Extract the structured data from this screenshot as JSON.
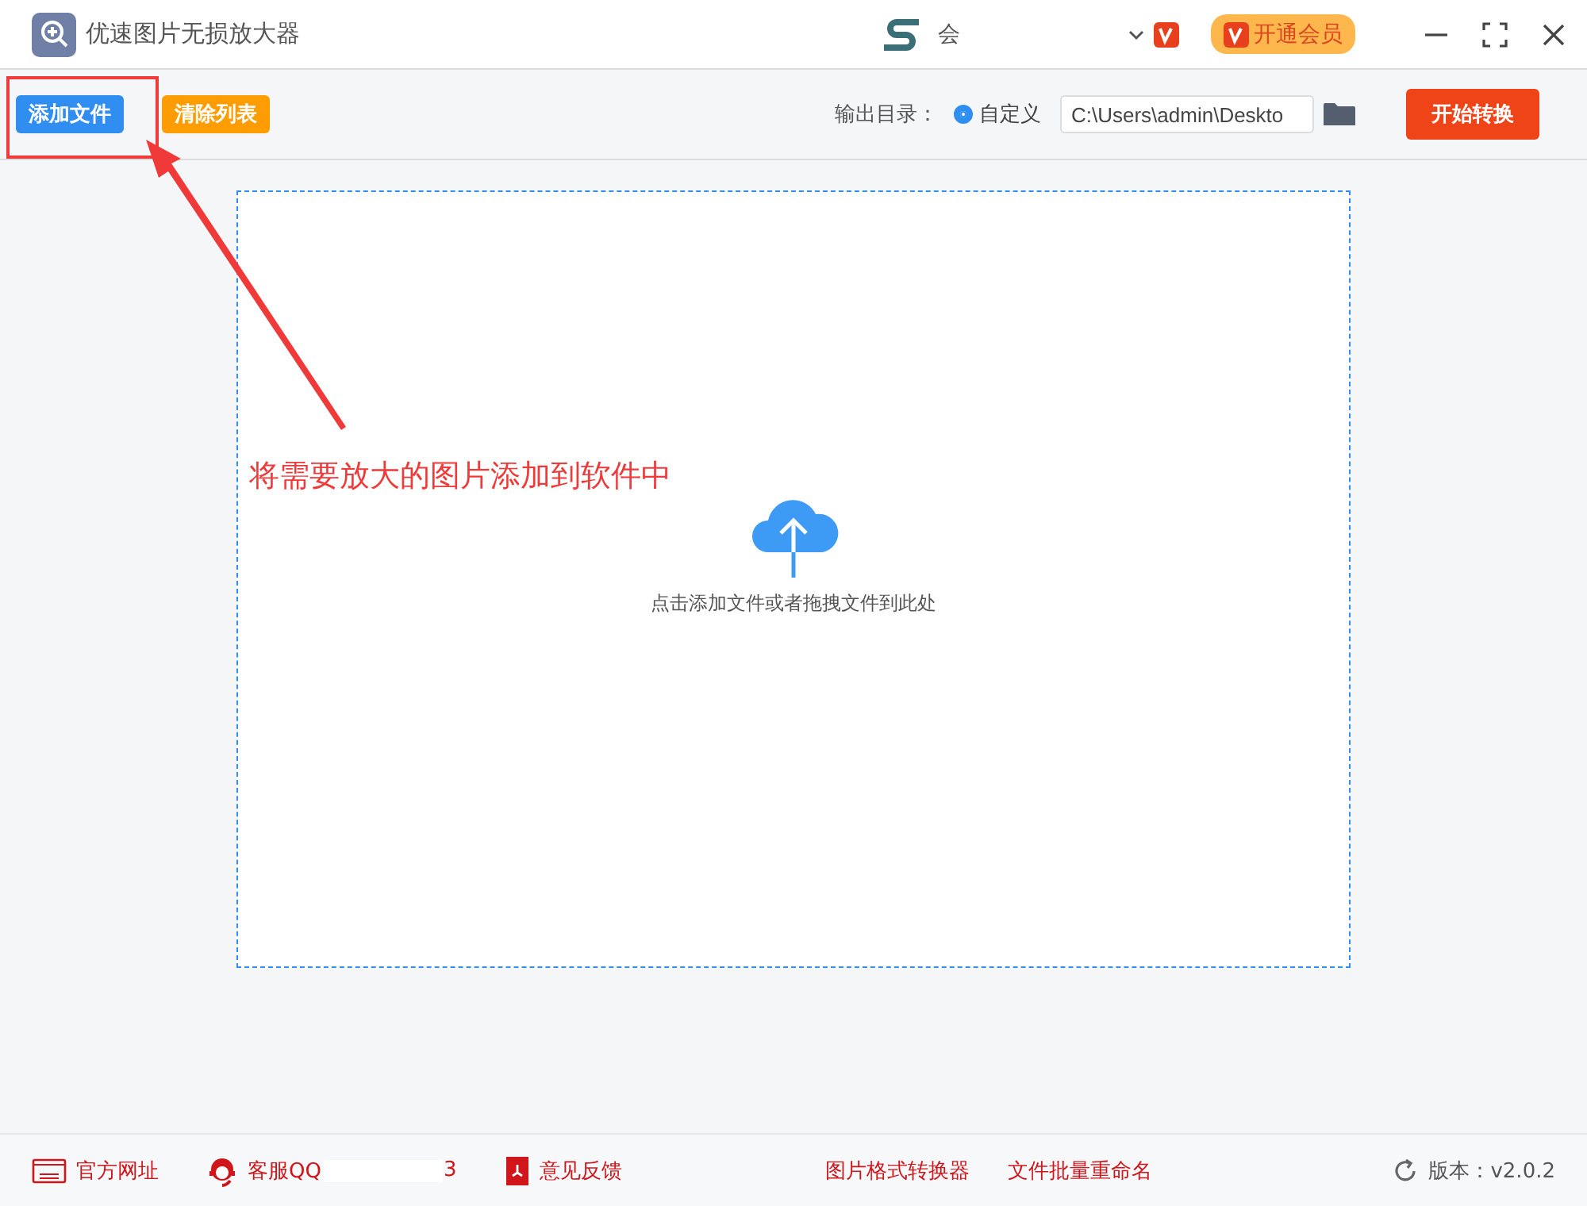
{
  "window": {
    "title": "优速图片无损放大器"
  },
  "account": {
    "name": "会"
  },
  "vip_button": {
    "label": "开通会员"
  },
  "toolbar": {
    "buttons": [
      {
        "label": "添加文件",
        "kind": "primary"
      },
      {
        "label": "清除列表",
        "kind": "warning"
      }
    ],
    "output_label": "输出目录：",
    "output_options": [
      {
        "label": "自定义",
        "selected": true
      }
    ],
    "output_path": "C:\\Users\\admin\\Deskto",
    "start_button": "开始转换"
  },
  "drop_zone": {
    "hint": "点击添加文件或者拖拽文件到此处"
  },
  "annotation": {
    "text": "将需要放大的图片添加到软件中"
  },
  "footer": {
    "links": [
      {
        "label": "官方网址",
        "kind": "web"
      },
      {
        "label": "客服QQ",
        "kind": "support",
        "suffix": "3"
      },
      {
        "label": "意见反馈",
        "kind": "feedback"
      }
    ],
    "tools": [
      "图片格式转换器",
      "文件批量重命名"
    ],
    "version": "版本：v2.0.2"
  }
}
